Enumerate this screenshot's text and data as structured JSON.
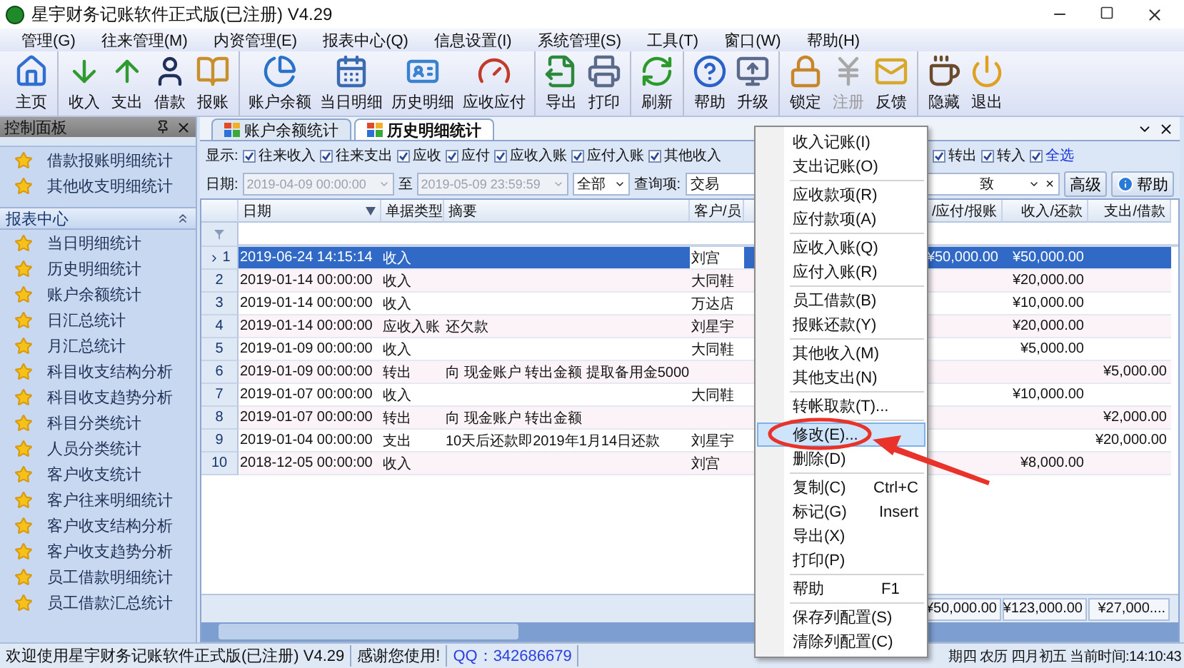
{
  "window": {
    "title": "星宇财务记账软件正式版(已注册) V4.29"
  },
  "menu_bar": [
    "管理(G)",
    "往来管理(M)",
    "内资管理(E)",
    "报表中心(Q)",
    "信息设置(I)",
    "系统管理(S)",
    "工具(T)",
    "窗口(W)",
    "帮助(H)"
  ],
  "toolbar": [
    [
      {
        "label": "主页",
        "disabled": false
      }
    ],
    [
      {
        "label": "收入",
        "disabled": false
      },
      {
        "label": "支出",
        "disabled": false
      },
      {
        "label": "借款",
        "disabled": false
      },
      {
        "label": "报账",
        "disabled": false
      }
    ],
    [
      {
        "label": "账户余额",
        "disabled": false
      },
      {
        "label": "当日明细",
        "disabled": false
      },
      {
        "label": "历史明细",
        "disabled": false
      },
      {
        "label": "应收应付",
        "disabled": false
      }
    ],
    [
      {
        "label": "导出",
        "disabled": false
      },
      {
        "label": "打印",
        "disabled": false
      }
    ],
    [
      {
        "label": "刷新",
        "disabled": false
      }
    ],
    [
      {
        "label": "帮助",
        "disabled": false
      },
      {
        "label": "升级",
        "disabled": false
      }
    ],
    [
      {
        "label": "锁定",
        "disabled": false
      },
      {
        "label": "注册",
        "disabled": true
      },
      {
        "label": "反馈",
        "disabled": false
      }
    ],
    [
      {
        "label": "隐藏",
        "disabled": false
      },
      {
        "label": "退出",
        "disabled": false
      }
    ]
  ],
  "sidebar": {
    "title": "控制面板",
    "items": [
      "借款报账明细统计",
      "其他收支明细统计"
    ],
    "section": {
      "title": "报表中心",
      "items": [
        "当日明细统计",
        "历史明细统计",
        "账户余额统计",
        "日汇总统计",
        "月汇总统计",
        "科目收支结构分析",
        "科目收支趋势分析",
        "科目分类统计",
        "人员分类统计",
        "客户收支统计",
        "客户往来明细统计",
        "客户收支结构分析",
        "客户收支趋势分析",
        "员工借款明细统计",
        "员工借款汇总统计"
      ]
    }
  },
  "tabs": [
    {
      "label": "账户余额统计",
      "selected": false
    },
    {
      "label": "历史明细统计",
      "selected": true
    }
  ],
  "filters": {
    "label": "显示:",
    "left": [
      {
        "label": "往来收入",
        "checked": true,
        "kind": "plain"
      },
      {
        "label": "往来支出",
        "checked": true,
        "kind": "plain"
      },
      {
        "label": "应收",
        "checked": true,
        "kind": "plain"
      },
      {
        "label": "应付",
        "checked": true,
        "kind": "plain"
      },
      {
        "label": "应收入账",
        "checked": true,
        "kind": "plain"
      },
      {
        "label": "应付入账",
        "checked": true,
        "kind": "plain"
      },
      {
        "label": "其他收入",
        "checked": true,
        "kind": "plain"
      }
    ],
    "right": [
      {
        "label": "转出",
        "checked": true,
        "kind": "plain"
      },
      {
        "label": "转入",
        "checked": true,
        "kind": "plain"
      },
      {
        "label": "全选",
        "checked": true,
        "kind": "link"
      }
    ]
  },
  "query": {
    "date_label": "日期:",
    "from": "2019-04-09 00:00:00",
    "to_label": "至",
    "to": "2019-05-09 23:59:59",
    "scope": "全部",
    "field_label": "查询项:",
    "field_start": "交易",
    "field_end": "致",
    "clear": "×",
    "advanced": "高级",
    "help": "帮助"
  },
  "table": {
    "columns": [
      "日期",
      "单据类型",
      "摘要",
      "客户/员",
      "/应付/报账",
      "收入/还款",
      "支出/借款"
    ],
    "rows": [
      {
        "no": "1",
        "date": "2019-06-24 14:15:14",
        "type": "收入",
        "party": "刘宫",
        "receivable": "¥50,000.00",
        "income": "¥50,000.00",
        "selected": true
      },
      {
        "no": "2",
        "date": "2019-01-14 00:00:00",
        "type": "收入",
        "party": "大同鞋",
        "income": "¥20,000.00",
        "selected": false
      },
      {
        "no": "3",
        "date": "2019-01-14 00:00:00",
        "type": "收入",
        "party": "万达店",
        "income": "¥10,000.00",
        "selected": false
      },
      {
        "no": "4",
        "date": "2019-01-14 00:00:00",
        "type": "应收入账",
        "summary": "还欠款",
        "party": "刘星宇",
        "income": "¥20,000.00",
        "selected": false
      },
      {
        "no": "5",
        "date": "2019-01-09 00:00:00",
        "type": "收入",
        "party": "大同鞋",
        "income": "¥5,000.00",
        "selected": false
      },
      {
        "no": "6",
        "date": "2019-01-09 00:00:00",
        "type": "转出",
        "summary": "向 现金账户 转出金额 提取备用金5000",
        "expense": "¥5,000.00",
        "selected": false
      },
      {
        "no": "7",
        "date": "2019-01-07 00:00:00",
        "type": "收入",
        "party": "大同鞋",
        "income": "¥10,000.00",
        "selected": false
      },
      {
        "no": "8",
        "date": "2019-01-07 00:00:00",
        "type": "转出",
        "summary": "向 现金账户 转出金额",
        "expense": "¥2,000.00",
        "selected": false
      },
      {
        "no": "9",
        "date": "2019-01-04 00:00:00",
        "type": "支出",
        "summary": "10天后还款即2019年1月14日还款",
        "party": "刘星宇",
        "expense": "¥20,000.00",
        "selected": false
      },
      {
        "no": "10",
        "date": "2018-12-05 00:00:00",
        "type": "收入",
        "party": "刘宫",
        "income": "¥8,000.00",
        "selected": false
      }
    ],
    "totals": [
      "¥50,000.00",
      "¥123,000.00",
      "¥27,000...."
    ]
  },
  "context_menu": [
    [
      {
        "label": "收入记账(I)",
        "highlighted": false
      },
      {
        "label": "支出记账(O)",
        "highlighted": false
      }
    ],
    [
      {
        "label": "应收款项(R)",
        "highlighted": false
      },
      {
        "label": "应付款项(A)",
        "highlighted": false
      }
    ],
    [
      {
        "label": "应收入账(Q)",
        "highlighted": false
      },
      {
        "label": "应付入账(R)",
        "highlighted": false
      }
    ],
    [
      {
        "label": "员工借款(B)",
        "highlighted": false
      },
      {
        "label": "报账还款(Y)",
        "highlighted": false
      }
    ],
    [
      {
        "label": "其他收入(M)",
        "highlighted": false
      },
      {
        "label": "其他支出(N)",
        "highlighted": false
      }
    ],
    [
      {
        "label": "转帐取款(T)...",
        "highlighted": false
      }
    ],
    [
      {
        "label": "修改(E)...",
        "highlighted": true
      },
      {
        "label": "删除(D)",
        "highlighted": false
      }
    ],
    [
      {
        "label": "复制(C)",
        "shortcut": "Ctrl+C",
        "highlighted": false
      },
      {
        "label": "标记(G)",
        "shortcut": "Insert",
        "highlighted": false
      },
      {
        "label": "导出(X)",
        "highlighted": false
      },
      {
        "label": "打印(P)",
        "highlighted": false
      }
    ],
    [
      {
        "label": "帮助",
        "shortcut": "F1",
        "highlighted": false
      }
    ],
    [
      {
        "label": "保存列配置(S)",
        "highlighted": false
      },
      {
        "label": "清除列配置(C)",
        "highlighted": false
      }
    ]
  ],
  "status_bar": {
    "left": [
      "欢迎使用星宇财务记账软件正式版(已注册) V4.29",
      "感谢您使用!"
    ],
    "qq": "QQ：342686679",
    "right": "期四 农历 四月初五 当前时间:14:10:43"
  }
}
